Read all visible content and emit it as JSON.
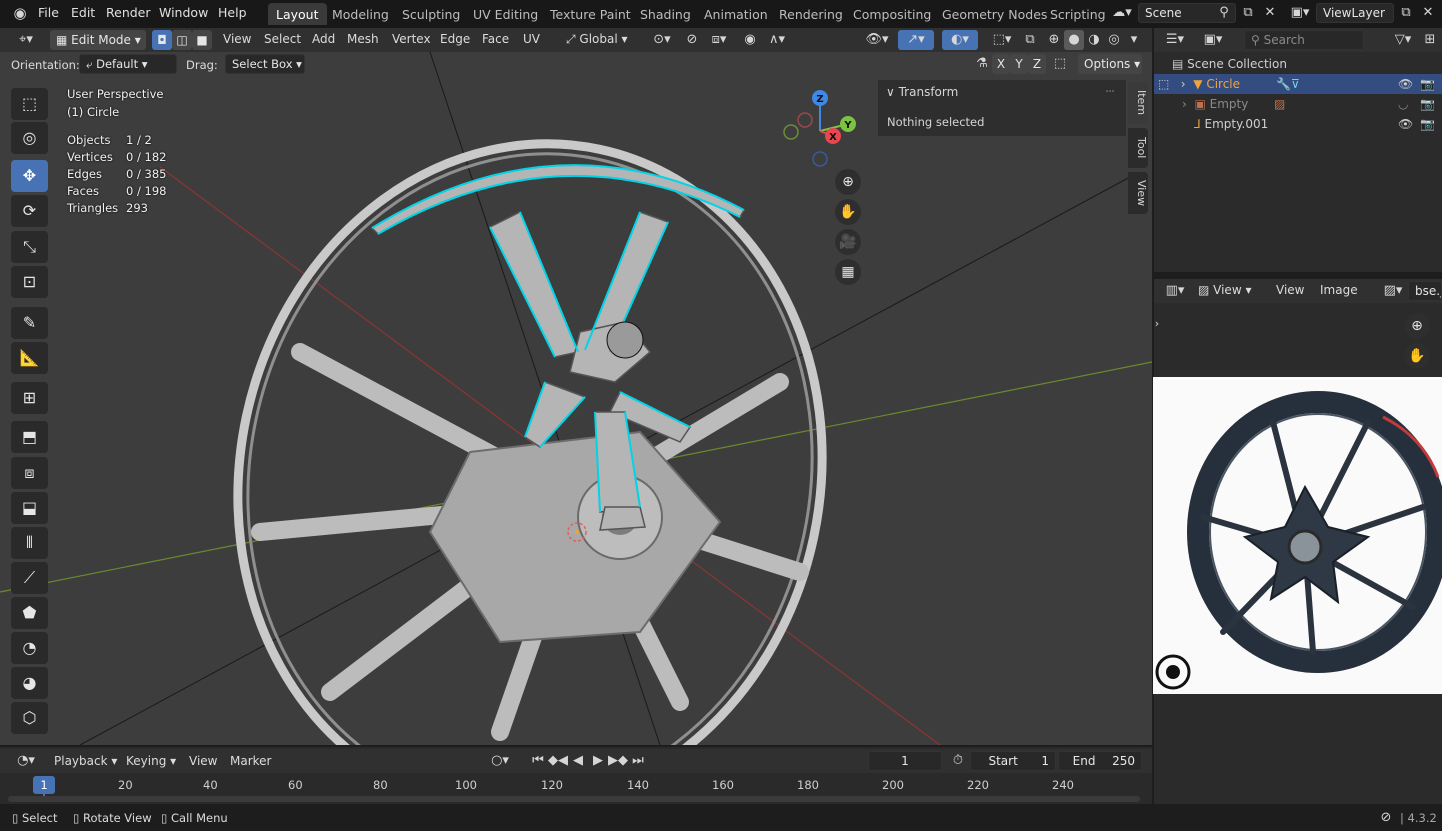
{
  "menus": [
    "File",
    "Edit",
    "Render",
    "Window",
    "Help"
  ],
  "workspaces": [
    "Layout",
    "Modeling",
    "Sculpting",
    "UV Editing",
    "Texture Paint",
    "Shading",
    "Animation",
    "Rendering",
    "Compositing",
    "Geometry Nodes",
    "Scripting"
  ],
  "scene": {
    "name": "Scene",
    "view_layer": "ViewLayer"
  },
  "header": {
    "mode": "Edit Mode",
    "menu": [
      "View",
      "Select",
      "Add",
      "Mesh",
      "Vertex",
      "Edge",
      "Face",
      "UV"
    ],
    "transform_orientation": "Global"
  },
  "tool_settings": {
    "orientation_label": "Orientation:",
    "orientation_value": "Default",
    "drag_label": "Drag:",
    "drag_value": "Select Box",
    "axes": [
      "X",
      "Y",
      "Z"
    ],
    "options": "Options"
  },
  "viewport": {
    "title": "User Perspective",
    "object": "(1) Circle",
    "stats": [
      {
        "label": "Objects",
        "value": "1 / 2"
      },
      {
        "label": "Vertices",
        "value": "0 / 182"
      },
      {
        "label": "Edges",
        "value": "0 / 385"
      },
      {
        "label": "Faces",
        "value": "0 / 198"
      },
      {
        "label": "Triangles",
        "value": "293"
      }
    ],
    "gizmo": {
      "z": "Z",
      "y": "Y",
      "x": "X"
    },
    "tabs": [
      "Item",
      "Tool",
      "View"
    ]
  },
  "npanel": {
    "title": "Transform",
    "message": "Nothing selected"
  },
  "outliner": {
    "search_placeholder": "Search",
    "root": "Scene Collection",
    "items": [
      {
        "name": "Circle",
        "selected": true
      },
      {
        "name": "Empty",
        "selected": false
      },
      {
        "name": "Empty.001",
        "selected": false
      }
    ]
  },
  "image_editor": {
    "view": "View",
    "menu": [
      "View",
      "Image"
    ],
    "image_name": "bse.j"
  },
  "timeline": {
    "playback": "Playback",
    "keying": "Keying",
    "view": "View",
    "marker": "Marker",
    "current_frame": "1",
    "start_label": "Start",
    "start": "1",
    "end_label": "End",
    "end": "250",
    "ticks": [
      "1",
      "20",
      "40",
      "60",
      "80",
      "100",
      "120",
      "140",
      "160",
      "180",
      "200",
      "220",
      "240"
    ]
  },
  "statusbar": {
    "select": "Select",
    "rotate": "Rotate View",
    "call_menu": "Call Menu",
    "version": "4.3.2"
  },
  "colors": {
    "accent": "#4772b3",
    "selection_edge": "#00d5e8",
    "active_object": "#f0a33a",
    "axis_x": "#e84650",
    "axis_y": "#7cc340",
    "axis_z": "#3e88e6"
  }
}
